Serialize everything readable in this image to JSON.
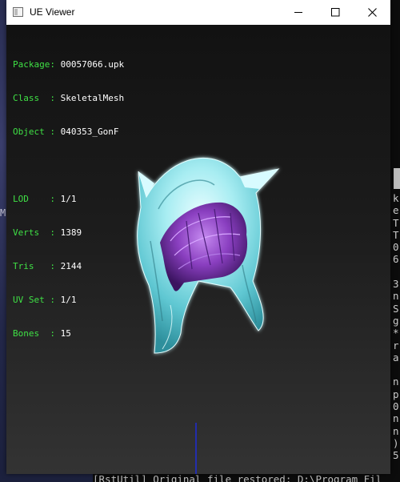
{
  "window": {
    "title": "UE Viewer",
    "controls": {
      "minimize": "minimize",
      "maximize": "maximize",
      "close": "close"
    }
  },
  "info": {
    "package": {
      "key": "Package: ",
      "value": "00057066.upk"
    },
    "class": {
      "key": "Class  : ",
      "value": "SkeletalMesh"
    },
    "object": {
      "key": "Object : ",
      "value": "040353_GonF"
    },
    "lod": {
      "key": "LOD    : ",
      "value": "1/1"
    },
    "verts": {
      "key": "Verts  : ",
      "value": "1389"
    },
    "tris": {
      "key": "Tris   : ",
      "value": "2144"
    },
    "uvset": {
      "key": "UV Set : ",
      "value": "1/1"
    },
    "bones": {
      "key": "Bones  : ",
      "value": "15"
    }
  },
  "desktop": {
    "edge_letter": "M"
  },
  "console": {
    "lines": [
      "k",
      "e",
      "T",
      "T",
      "0",
      "6",
      "",
      "3",
      "n",
      "S",
      "g",
      "*",
      "r",
      "a",
      "",
      "n",
      "p",
      "0",
      "n",
      "n",
      ")",
      "5"
    ],
    "bottom_line": "[RstUtil] Original file restored: D:\\Program Fil"
  },
  "colors": {
    "label_green": "#3fe045",
    "value_white": "#ffffff",
    "mesh_cyan": "#9ee9ef",
    "hair_purple": "#8a3fc0",
    "axis_blue": "#1a2cff"
  }
}
